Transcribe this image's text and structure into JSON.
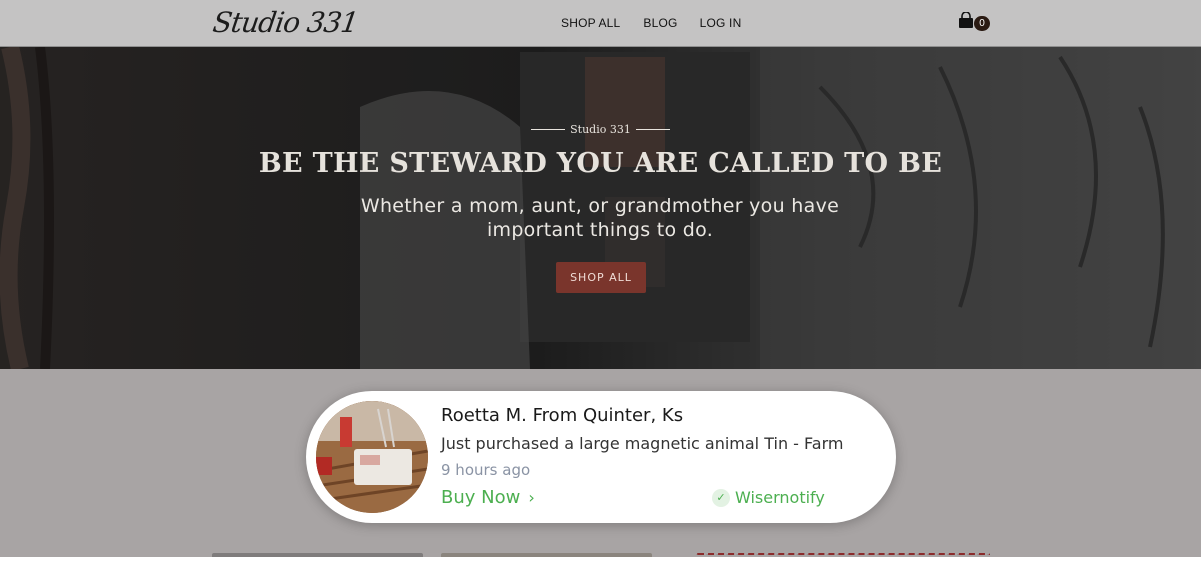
{
  "header": {
    "logo_text": "Studio 331",
    "nav": [
      {
        "label": "SHOP ALL"
      },
      {
        "label": "BLOG"
      },
      {
        "label": "LOG IN"
      }
    ],
    "cart": {
      "icon": "shopping-bag-icon",
      "count": "0"
    }
  },
  "hero": {
    "eyebrow": "Studio 331",
    "title": "BE THE STEWARD YOU ARE CALLED TO BE",
    "subtitle": "Whether a mom, aunt, or grandmother you have important things to do.",
    "button_label": "SHOP ALL",
    "button_color": "#7a352c"
  },
  "notification": {
    "name": "Roetta M. From Quinter, Ks",
    "message": "Just purchased a large magnetic animal Tin - Farm",
    "time": "9 hours ago",
    "cta_label": "Buy Now",
    "cta_icon": "chevron-right-icon",
    "brand": "Wisernotify",
    "brand_icon": "check-circle-icon",
    "accent_color": "#4caf50"
  }
}
